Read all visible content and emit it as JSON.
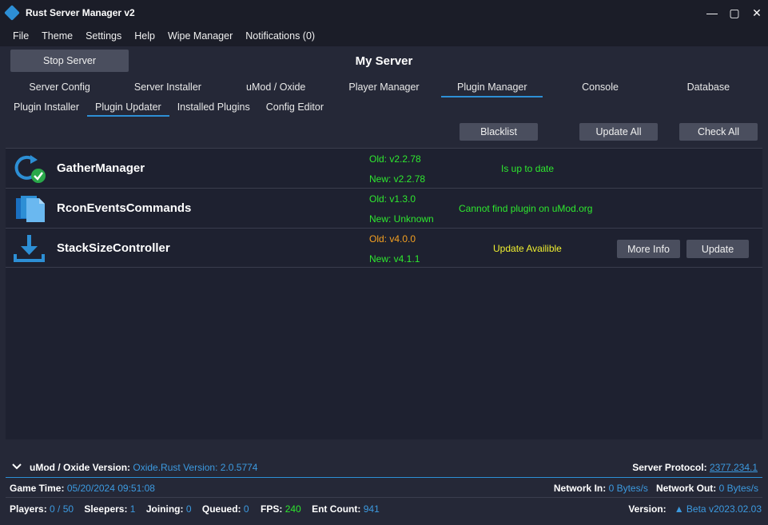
{
  "window": {
    "title": "Rust Server Manager v2"
  },
  "menu": [
    "File",
    "Theme",
    "Settings",
    "Help",
    "Wipe Manager",
    "Notifications (0)"
  ],
  "header": {
    "stop_label": "Stop Server",
    "server_name": "My Server"
  },
  "main_tabs": [
    "Server Config",
    "Server Installer",
    "uMod / Oxide",
    "Player Manager",
    "Plugin Manager",
    "Console",
    "Database"
  ],
  "active_main_tab": "Plugin Manager",
  "sub_tabs": [
    "Plugin Installer",
    "Plugin Updater",
    "Installed Plugins",
    "Config Editor"
  ],
  "active_sub_tab": "Plugin Updater",
  "toolbar": {
    "blacklist": "Blacklist",
    "update_all": "Update All",
    "check_all": "Check All"
  },
  "plugins": [
    {
      "name": "GatherManager",
      "old": "Old: v2.2.78",
      "new": "New: v2.2.78",
      "status": "Is up to date",
      "icon": "refresh-check-icon"
    },
    {
      "name": "RconEventsCommands",
      "old": "Old: v1.3.0",
      "new": "New: Unknown",
      "status": "Cannot find plugin on uMod.org",
      "icon": "documents-icon"
    },
    {
      "name": "StackSizeController",
      "old": "Old: v4.0.0",
      "new": "New: v4.1.1",
      "status": "Update Availible",
      "more_info": "More Info",
      "update": "Update",
      "icon": "download-icon"
    }
  ],
  "status": {
    "umod_label": "uMod / Oxide Version:",
    "umod_value": "Oxide.Rust Version: 2.0.5774",
    "protocol_label": "Server Protocol:",
    "protocol_value": "2377.234.1",
    "game_time_label": "Game Time:",
    "game_time_value": "05/20/2024 09:51:08",
    "net_in_label": "Network In:",
    "net_in_value": "0 Bytes/s",
    "net_out_label": "Network Out:",
    "net_out_value": "0 Bytes/s",
    "players_label": "Players:",
    "players_value": "0 / 50",
    "sleepers_label": "Sleepers:",
    "sleepers_value": "1",
    "joining_label": "Joining:",
    "joining_value": "0",
    "queued_label": "Queued:",
    "queued_value": "0",
    "fps_label": "FPS:",
    "fps_value": "240",
    "ent_label": "Ent Count:",
    "ent_value": "941",
    "version_label": "Version:",
    "version_value": "Beta v2023.02.03"
  },
  "colors": {
    "accent": "#2d8fd5",
    "ok": "#2ee82e",
    "warn": "#f4a020",
    "highlight": "#f0f030"
  }
}
